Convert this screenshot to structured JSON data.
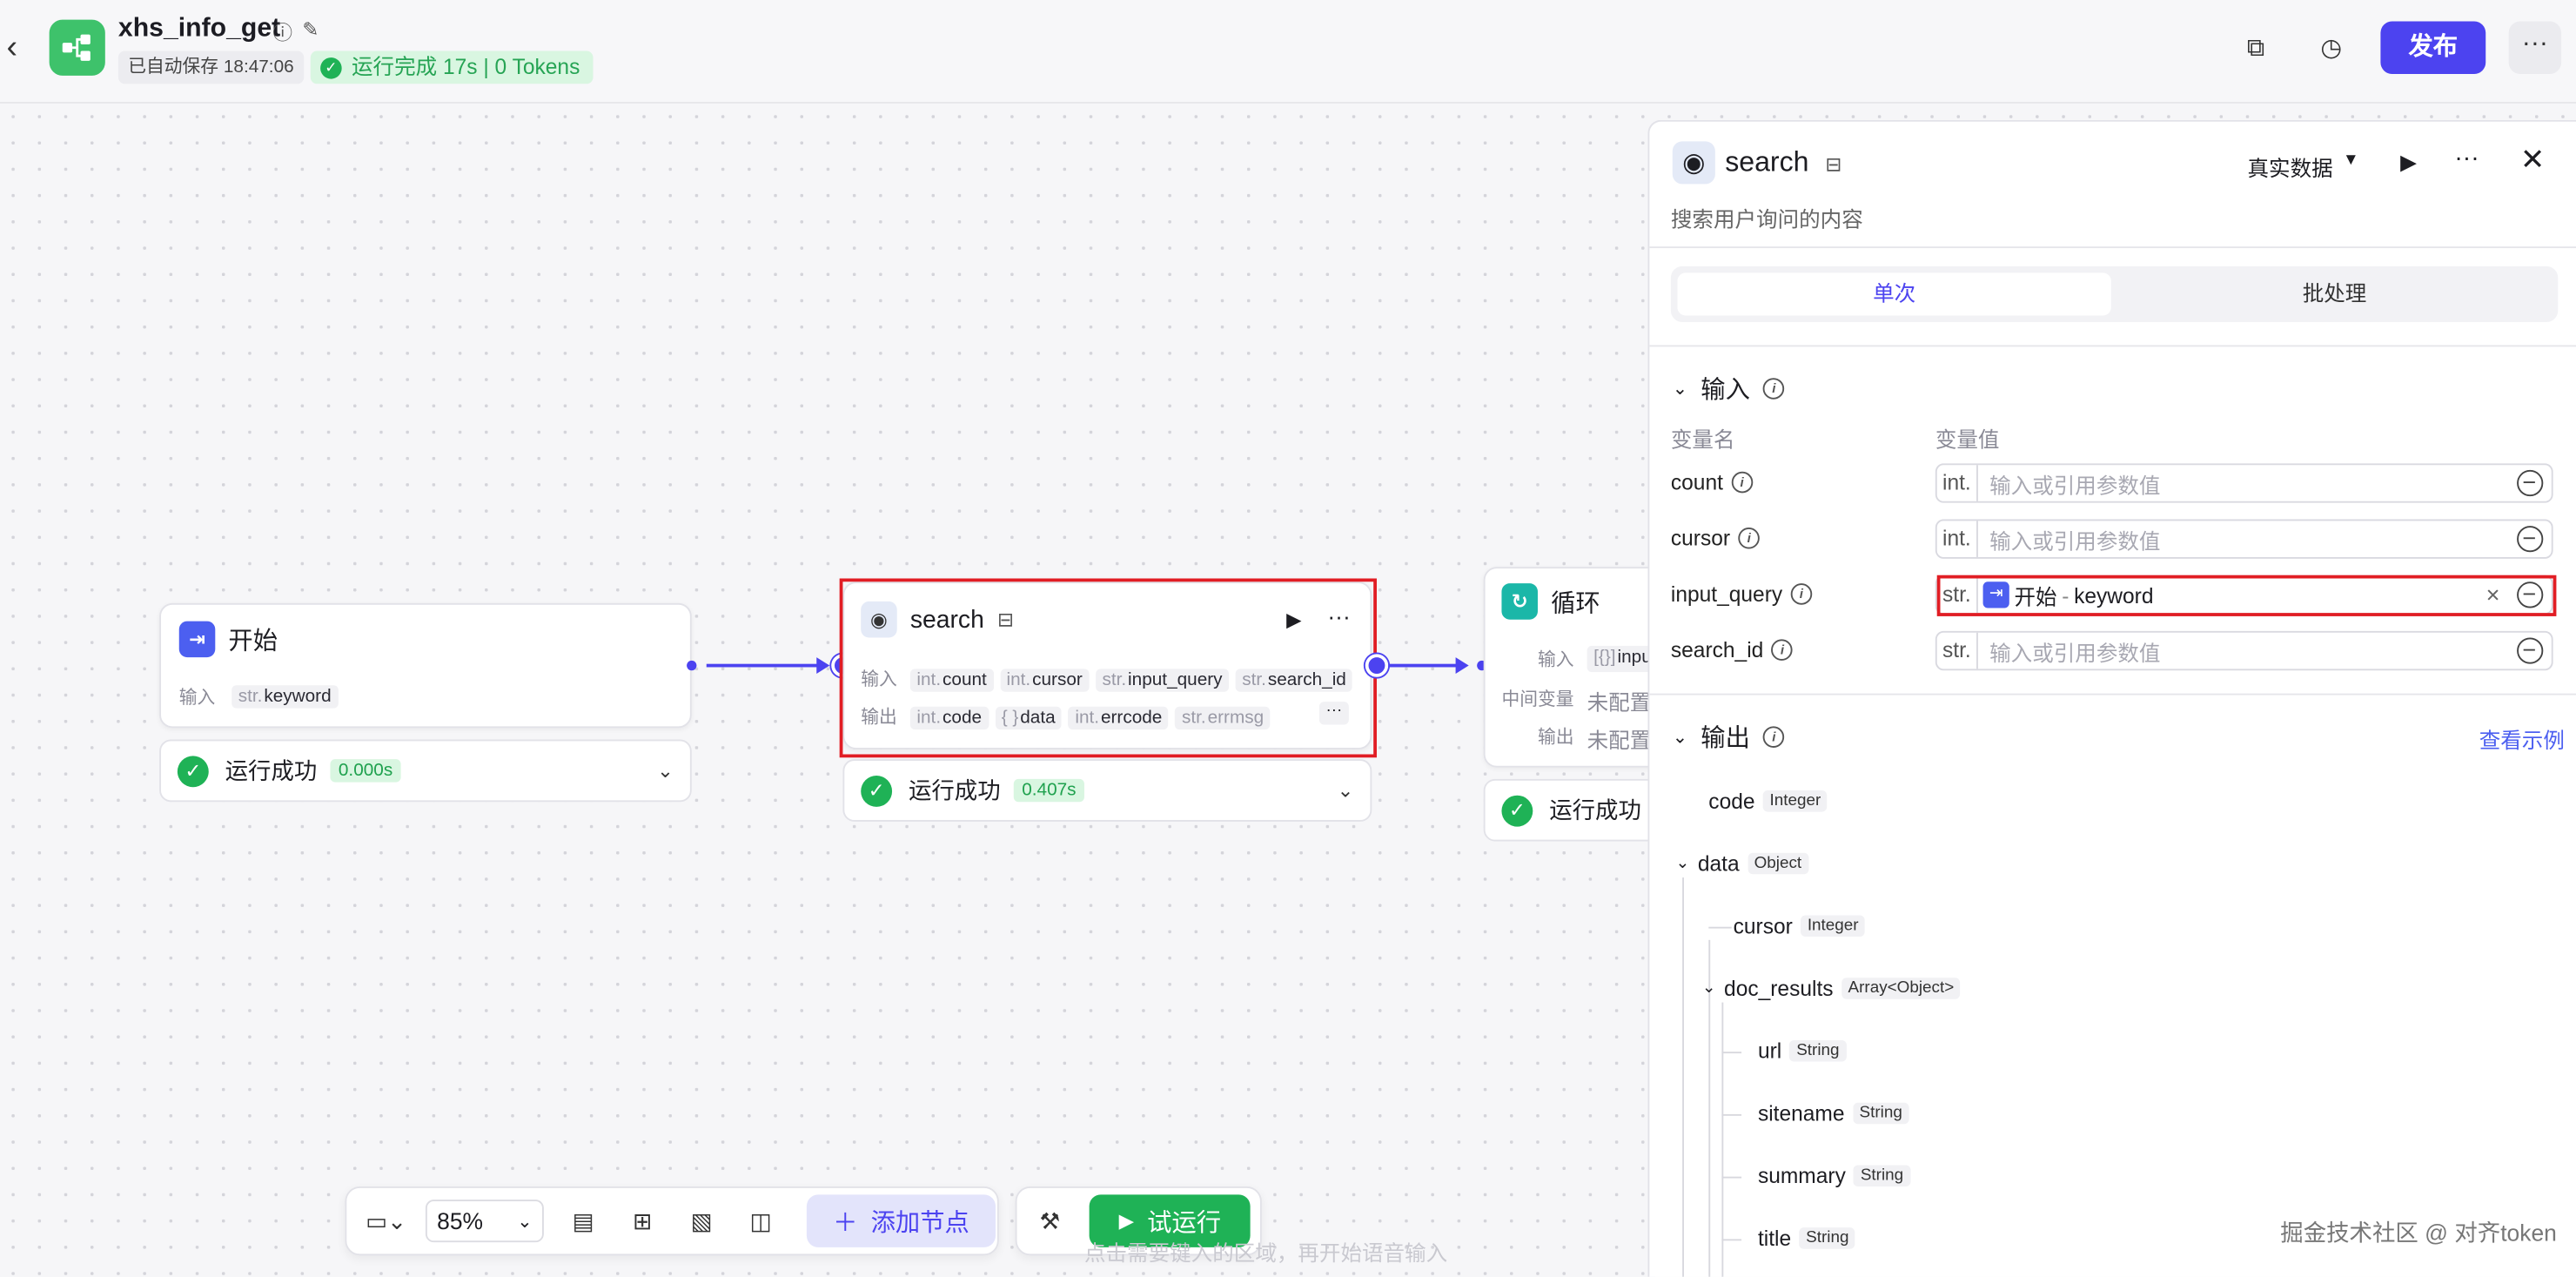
{
  "header": {
    "back_icon": "‹",
    "title": "xhs_info_get",
    "saved_text": "已自动保存 18:47:06",
    "run_status": "运行完成 17s | 0 Tokens",
    "publish_label": "发布",
    "more_icon": "···"
  },
  "nodes": {
    "start": {
      "title": "开始",
      "input_label": "输入",
      "input_tag_type": "str.",
      "input_tag_name": "keyword",
      "status": "运行成功",
      "time": "0.000s"
    },
    "search": {
      "title": "search",
      "input_label": "输入",
      "output_label": "输出",
      "inputs": [
        {
          "type": "int.",
          "name": "count"
        },
        {
          "type": "int.",
          "name": "cursor"
        },
        {
          "type": "str.",
          "name": "input_query"
        },
        {
          "type": "str.",
          "name": "search_id"
        }
      ],
      "outputs": [
        {
          "type": "int.",
          "name": "code"
        },
        {
          "type": "{ }",
          "name": "data"
        },
        {
          "type": "int.",
          "name": "errcode"
        },
        {
          "type": "str.",
          "name": "errmsg"
        }
      ],
      "more": "···",
      "status": "运行成功",
      "time": "0.407s"
    },
    "loop": {
      "title": "循环",
      "input_label": "输入",
      "input_tag_type": "[{}]",
      "input_tag_name": "inpu",
      "middle_label": "中间变量",
      "middle_value": "未配置",
      "output_label": "输出",
      "output_value": "未配置",
      "status": "运行成功"
    }
  },
  "toolbar": {
    "zoom": "85%",
    "add_node": "添加节点",
    "test_run": "试运行"
  },
  "canvas_hint": "点击需要键入的区域，再开始语音输入",
  "watermark": "掘金技术社区 @ 对齐token",
  "panel": {
    "title": "search",
    "description": "搜索用户询问的内容",
    "data_mode": "真实数据",
    "tabs": [
      "单次",
      "批处理"
    ],
    "input_section": "输入",
    "col_name": "变量名",
    "col_value": "变量值",
    "inputs": [
      {
        "name": "count",
        "type": "int.",
        "placeholder": "输入或引用参数值"
      },
      {
        "name": "cursor",
        "type": "int.",
        "placeholder": "输入或引用参数值"
      },
      {
        "name": "input_query",
        "type": "str.",
        "ref_node": "开始",
        "ref_sep": "-",
        "ref_var": "keyword"
      },
      {
        "name": "search_id",
        "type": "str.",
        "placeholder": "输入或引用参数值"
      }
    ],
    "output_section": "输出",
    "view_example": "查看示例",
    "outputs": [
      {
        "name": "code",
        "type": "Integer"
      },
      {
        "name": "data",
        "type": "Object"
      },
      {
        "name": "cursor",
        "type": "Integer"
      },
      {
        "name": "doc_results",
        "type": "Array<Object>"
      },
      {
        "name": "url",
        "type": "String"
      },
      {
        "name": "sitename",
        "type": "String"
      },
      {
        "name": "summary",
        "type": "String"
      },
      {
        "name": "title",
        "type": "String"
      }
    ]
  },
  "colors": {
    "accent": "#4c43f0",
    "success": "#1fb256",
    "highlight": "#e11d24"
  }
}
